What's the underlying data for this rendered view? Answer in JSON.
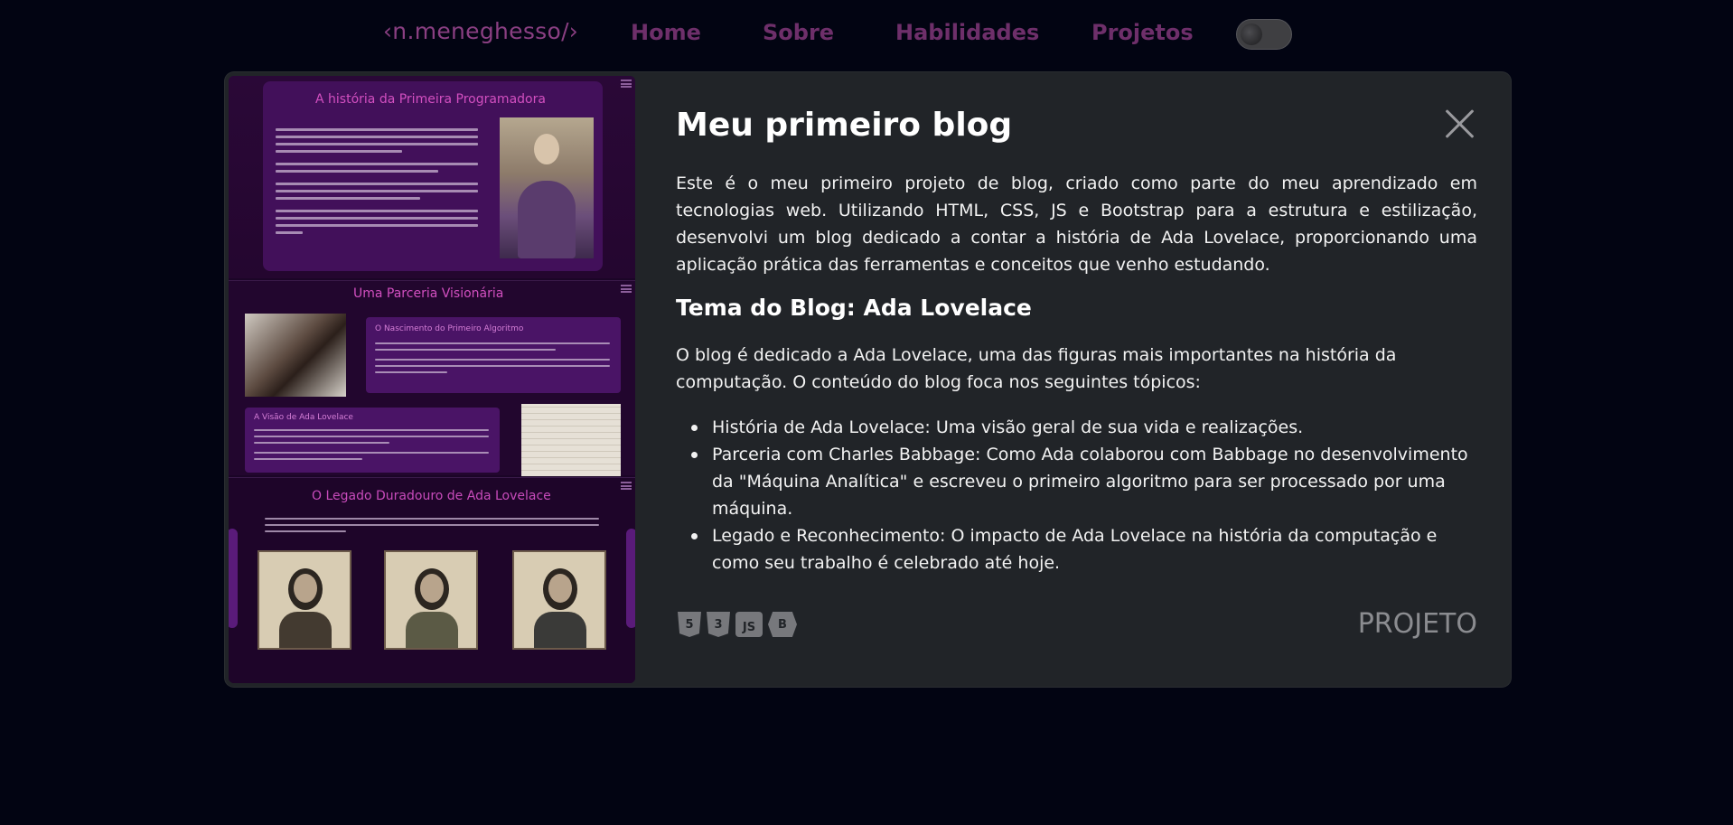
{
  "nav": {
    "brand": "‹n.meneghesso/›",
    "links": [
      "Home",
      "Sobre",
      "Habilidades",
      "Projetos"
    ]
  },
  "modal": {
    "title": "Meu primeiro blog",
    "intro": "Este é o meu primeiro projeto de blog, criado como parte do meu aprendizado em tecnologias web. Utilizando HTML, CSS, JS e Bootstrap para a estrutura e estilização, desenvolvi um blog dedicado a contar a história de Ada Lovelace, proporcionando uma aplicação prática das ferramentas e conceitos que venho estudando.",
    "subheading": "Tema do Blog: Ada Lovelace",
    "description": "O blog é dedicado a Ada Lovelace, uma das figuras mais importantes na história da computação. O conteúdo do blog foca nos seguintes tópicos:",
    "topics": [
      "História de Ada Lovelace: Uma visão geral de sua vida e realizações.",
      "Parceria com Charles Babbage: Como Ada colaborou com Babbage no desenvolvimento da \"Máquina Analítica\" e escreveu o primeiro algoritmo para ser processado por uma máquina.",
      "Legado e Reconhecimento: O impacto de Ada Lovelace na história da computação e como seu trabalho é celebrado até hoje."
    ],
    "tech_icons": [
      {
        "icon": "html5-icon",
        "glyph": "5"
      },
      {
        "icon": "css3-icon",
        "glyph": "3"
      },
      {
        "icon": "javascript-icon",
        "glyph": "JS"
      },
      {
        "icon": "bootstrap-icon",
        "glyph": "B"
      }
    ],
    "type_label": "PROJETO"
  },
  "preview": {
    "section1_title": "A história da Primeira Programadora",
    "section2_title": "Uma Parceria Visionária",
    "section2_card1_title": "O Nascimento do Primeiro Algoritmo",
    "section2_card2_title": "A Visão de Ada Lovelace",
    "section3_title": "O Legado Duradouro de Ada Lovelace"
  },
  "colors": {
    "background": "#020412",
    "modal": "#212428",
    "nav_link": "#6e2f6a",
    "preview_bg": "#1b0527",
    "preview_accent": "#d24fc0"
  }
}
